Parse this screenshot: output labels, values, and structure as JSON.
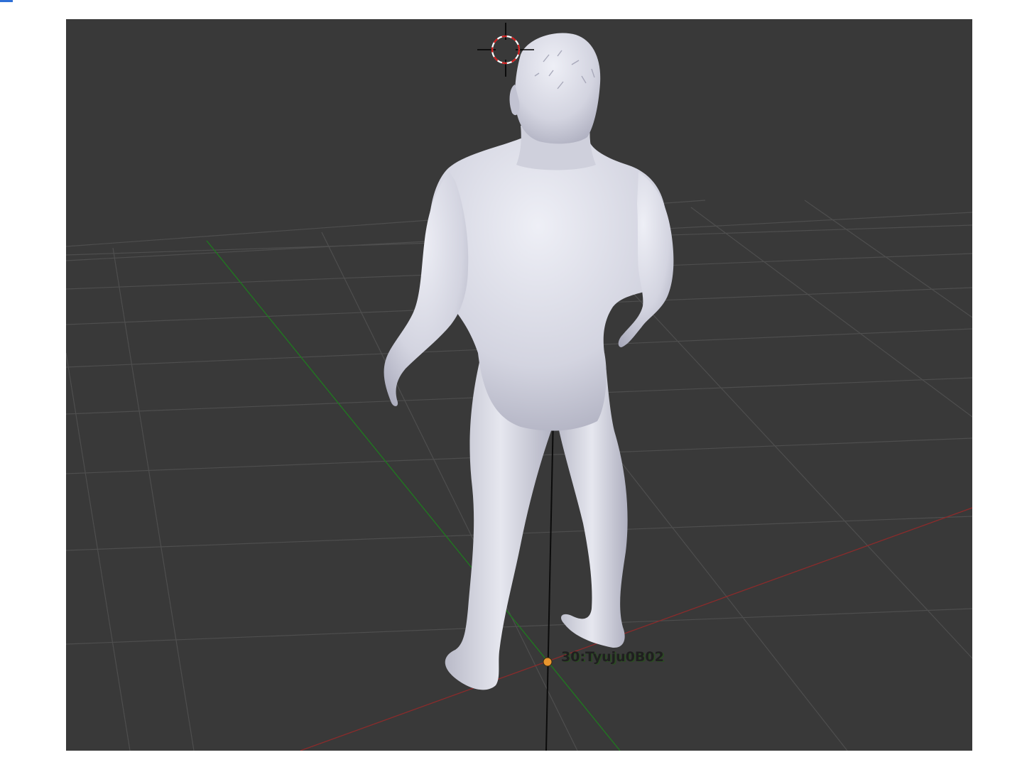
{
  "viewport": {
    "background_color": "#393939",
    "grid_color": "#4e4e4e",
    "x_axis_color": "#8b2b2b",
    "y_axis_color": "#1f7a1f",
    "z_axis_color": "#0b0b0b",
    "model_color": "#d9dae6"
  },
  "object": {
    "label": "30:Tyuju0B02",
    "origin_color": "#e8952e"
  },
  "cursor": {
    "ring_colors": [
      "#d11a1a",
      "#ffffff"
    ],
    "crosshair_color": "#000000"
  },
  "icons": {
    "cursor": "3d-cursor-icon",
    "origin": "object-origin-icon"
  }
}
